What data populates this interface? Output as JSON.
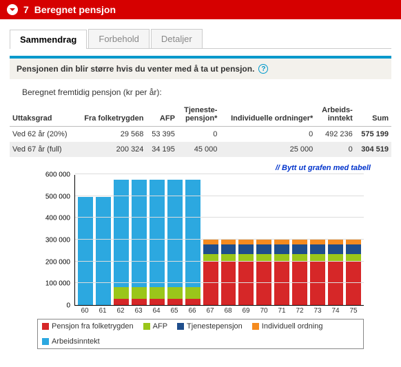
{
  "header": {
    "step": "7",
    "title": "Beregnet pensjon"
  },
  "tabs": [
    {
      "label": "Sammendrag",
      "active": true
    },
    {
      "label": "Forbehold",
      "active": false
    },
    {
      "label": "Detaljer",
      "active": false
    }
  ],
  "infobox": {
    "text": "Pensjonen din blir større hvis du venter med å ta ut pensjon."
  },
  "subtitle": "Beregnet fremtidig pensjon (kr per år):",
  "table": {
    "headers": {
      "uttaksgrad": "Uttaksgrad",
      "folketrygden": "Fra folketrygden",
      "afp": "AFP",
      "tjenestepensjon": "Tjeneste-\npensjon*",
      "individuelle": "Individuelle ordninger*",
      "arbeidsinntekt": "Arbeids-\ninntekt",
      "sum": "Sum"
    },
    "rows": [
      {
        "label": "Ved 62 år (20%)",
        "folketrygden": "29 568",
        "afp": "53 395",
        "tjenestepensjon": "0",
        "individuelle": "0",
        "arbeidsinntekt": "492 236",
        "sum": "575 199"
      },
      {
        "label": "Ved 67 år (full)",
        "folketrygden": "200 324",
        "afp": "34 195",
        "tjenestepensjon": "45 000",
        "individuelle": "25 000",
        "arbeidsinntekt": "0",
        "sum": "304 519"
      }
    ]
  },
  "swap_link": "// Bytt ut grafen med tabell",
  "legend": {
    "ft": "Pensjon fra folketrygden",
    "afp": "AFP",
    "tp": "Tjenestepensjon",
    "ind": "Individuell ordning",
    "arb": "Arbeidsinntekt"
  },
  "chart_data": {
    "type": "bar",
    "stacked": true,
    "ylim": [
      0,
      600000
    ],
    "yticks": [
      0,
      100000,
      200000,
      300000,
      400000,
      500000,
      600000
    ],
    "ytick_labels": [
      "0",
      "100 000",
      "200 000",
      "300 000",
      "400 000",
      "500 000",
      "600 000"
    ],
    "categories": [
      "60",
      "61",
      "62",
      "63",
      "64",
      "65",
      "66",
      "67",
      "68",
      "69",
      "70",
      "71",
      "72",
      "73",
      "74",
      "75"
    ],
    "series": [
      {
        "key": "ft",
        "name": "Pensjon fra folketrygden",
        "color": "#d62728",
        "values": [
          0,
          0,
          30000,
          30000,
          30000,
          30000,
          30000,
          200000,
          200000,
          200000,
          200000,
          200000,
          200000,
          200000,
          200000,
          200000
        ]
      },
      {
        "key": "afp",
        "name": "AFP",
        "color": "#9ac61a",
        "values": [
          0,
          0,
          53000,
          53000,
          53000,
          53000,
          53000,
          34000,
          34000,
          34000,
          34000,
          34000,
          34000,
          34000,
          34000,
          34000
        ]
      },
      {
        "key": "tp",
        "name": "Tjenestepensjon",
        "color": "#1f4e8c",
        "values": [
          0,
          0,
          0,
          0,
          0,
          0,
          0,
          45000,
          45000,
          45000,
          45000,
          45000,
          45000,
          45000,
          45000,
          45000
        ]
      },
      {
        "key": "ind",
        "name": "Individuell ordning",
        "color": "#f58b1f",
        "values": [
          0,
          0,
          0,
          0,
          0,
          0,
          0,
          25000,
          25000,
          25000,
          25000,
          25000,
          25000,
          25000,
          25000,
          25000
        ]
      },
      {
        "key": "arb",
        "name": "Arbeidsinntekt",
        "color": "#2ca8e0",
        "values": [
          495000,
          495000,
          492000,
          492000,
          492000,
          492000,
          492000,
          0,
          0,
          0,
          0,
          0,
          0,
          0,
          0,
          0
        ]
      }
    ]
  }
}
